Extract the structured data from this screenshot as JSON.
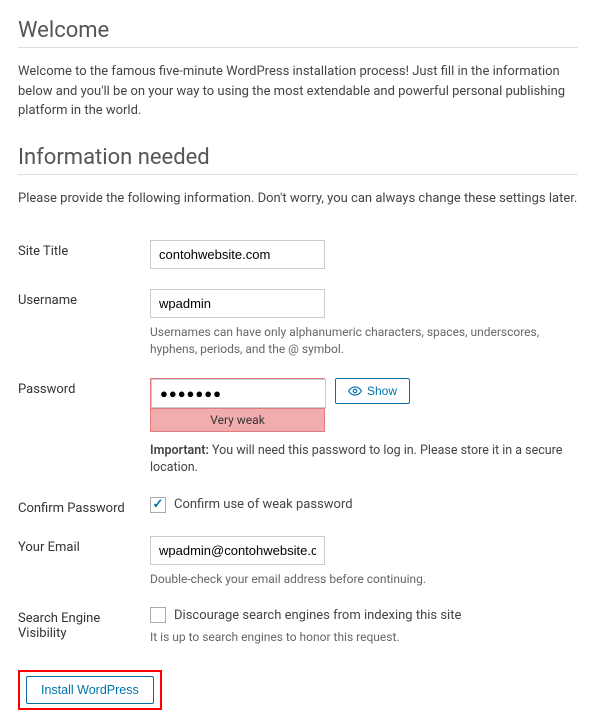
{
  "headings": {
    "welcome": "Welcome",
    "info_needed": "Information needed"
  },
  "intro": {
    "welcome_text": "Welcome to the famous five-minute WordPress installation process! Just fill in the information below and you'll be on your way to using the most extendable and powerful personal publishing platform in the world.",
    "info_text": "Please provide the following information. Don't worry, you can always change these settings later."
  },
  "fields": {
    "site_title": {
      "label": "Site Title",
      "value": "contohwebsite.com"
    },
    "username": {
      "label": "Username",
      "value": "wpadmin",
      "hint": "Usernames can have only alphanumeric characters, spaces, underscores, hyphens, periods, and the @ symbol."
    },
    "password": {
      "label": "Password",
      "value": "●●●●●●●",
      "strength": "Very weak",
      "show_btn": "Show",
      "important_label": "Important:",
      "important_text": " You will need this password to log in. Please store it in a secure location."
    },
    "confirm_password": {
      "label": "Confirm Password",
      "checkbox_label": "Confirm use of weak password",
      "checked": true
    },
    "email": {
      "label": "Your Email",
      "value": "wpadmin@contohwebsite.com",
      "hint": "Double-check your email address before continuing."
    },
    "search_visibility": {
      "label": "Search Engine Visibility",
      "checkbox_label": "Discourage search engines from indexing this site",
      "hint": "It is up to search engines to honor this request.",
      "checked": false
    }
  },
  "submit": {
    "label": "Install WordPress"
  }
}
